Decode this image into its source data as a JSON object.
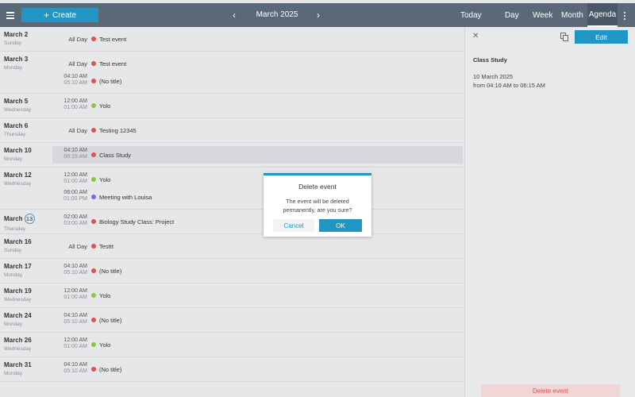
{
  "header": {
    "menu_icon": "hamburger-menu-icon",
    "create_label": "Create",
    "prev_icon": "chevron-left-icon",
    "next_icon": "chevron-right-icon",
    "month_title": "March 2025",
    "today_label": "Today",
    "views": [
      "Day",
      "Week",
      "Month",
      "Agenda"
    ],
    "active_view": "Agenda",
    "more_icon": "more-vertical-icon"
  },
  "agenda": {
    "days": [
      {
        "date": "March 2",
        "weekday": "Sunday",
        "events": [
          {
            "allday": "All Day",
            "title": "Test event",
            "color": "#d9534f"
          }
        ]
      },
      {
        "date": "March 3",
        "weekday": "Monday",
        "events": [
          {
            "allday": "All Day",
            "title": "Test event",
            "color": "#d9534f"
          },
          {
            "start": "04:10 AM",
            "end": "05:10 AM",
            "title": "(No title)",
            "color": "#d9534f"
          }
        ]
      },
      {
        "date": "March 5",
        "weekday": "Wednesday",
        "events": [
          {
            "start": "12:00 AM",
            "end": "01:00 AM",
            "title": "Yolo",
            "color": "#8bc34a"
          }
        ]
      },
      {
        "date": "March 6",
        "weekday": "Thursday",
        "events": [
          {
            "allday": "All Day",
            "title": "Testing 12345",
            "color": "#d9534f"
          }
        ]
      },
      {
        "date": "March 10",
        "weekday": "Monday",
        "events": [
          {
            "start": "04:10 AM",
            "end": "06:15 AM",
            "title": "Class Study",
            "color": "#d9534f",
            "selected": true
          }
        ]
      },
      {
        "date": "March 12",
        "weekday": "Wednesday",
        "events": [
          {
            "start": "12:00 AM",
            "end": "01:00 AM",
            "title": "Yolo",
            "color": "#8bc34a"
          },
          {
            "start": "06:00 AM",
            "end": "01:00 PM",
            "title": "Meeting with Louisa",
            "color": "#7b68ee"
          }
        ]
      },
      {
        "date": "March",
        "day_number": "13",
        "weekday": "Thursday",
        "today": true,
        "events": [
          {
            "start": "02:00 AM",
            "end": "03:00 AM",
            "title": "Biology Study Class: Project",
            "color": "#d9534f"
          }
        ]
      },
      {
        "date": "March 16",
        "weekday": "Sunday",
        "events": [
          {
            "allday": "All Day",
            "title": "Testtt",
            "color": "#d9534f"
          }
        ]
      },
      {
        "date": "March 17",
        "weekday": "Monday",
        "events": [
          {
            "start": "04:10 AM",
            "end": "05:10 AM",
            "title": "(No title)",
            "color": "#d9534f"
          }
        ]
      },
      {
        "date": "March 19",
        "weekday": "Wednesday",
        "events": [
          {
            "start": "12:00 AM",
            "end": "01:00 AM",
            "title": "Yolo",
            "color": "#8bc34a"
          }
        ]
      },
      {
        "date": "March 24",
        "weekday": "Monday",
        "events": [
          {
            "start": "04:10 AM",
            "end": "05:10 AM",
            "title": "(No title)",
            "color": "#d9534f"
          }
        ]
      },
      {
        "date": "March 26",
        "weekday": "Wednesday",
        "events": [
          {
            "start": "12:00 AM",
            "end": "01:00 AM",
            "title": "Yolo",
            "color": "#8bc34a"
          }
        ]
      },
      {
        "date": "March 31",
        "weekday": "Monday",
        "events": [
          {
            "start": "04:10 AM",
            "end": "05:10 AM",
            "title": "(No title)",
            "color": "#d9534f"
          }
        ]
      }
    ]
  },
  "panel": {
    "close_icon": "close-icon",
    "copy_icon": "copy-icon",
    "edit_label": "Edit",
    "event_title": "Class Study",
    "event_date": "10 March 2025",
    "event_range": "from 04:10 AM to 06:15 AM",
    "delete_label": "Delete event"
  },
  "dialog": {
    "title": "Delete event",
    "message": "The event will be deleted permanently, are you sure?",
    "cancel_label": "Cancel",
    "ok_label": "OK"
  },
  "colors": {
    "header_bg": "#5a6878",
    "accent": "#2196c4",
    "danger": "#d9534f"
  }
}
